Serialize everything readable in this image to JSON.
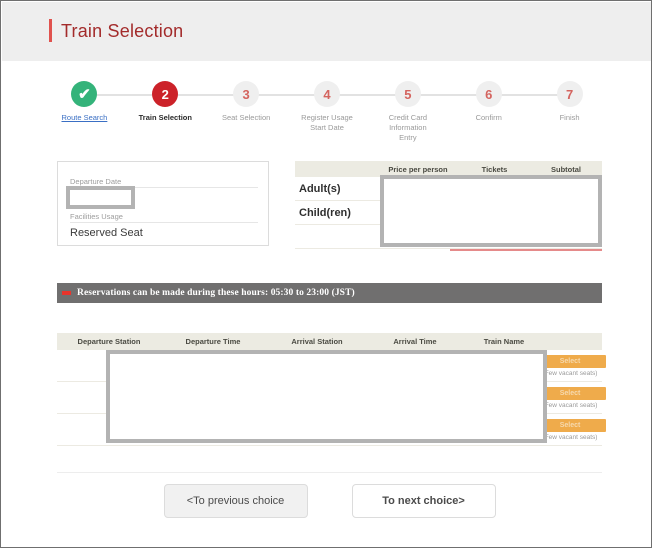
{
  "header": {
    "title": "Train Selection",
    "accent_color": "#e0524e",
    "title_color": "#a32b2b"
  },
  "stepper": {
    "steps": [
      {
        "number": "✔",
        "label": "Route Search",
        "state": "done"
      },
      {
        "number": "2",
        "label": "Train Selection",
        "state": "active"
      },
      {
        "number": "3",
        "label": "Seat Selection",
        "state": "todo"
      },
      {
        "number": "4",
        "label": "Register Usage\nStart Date",
        "state": "todo"
      },
      {
        "number": "5",
        "label": "Credit Card\nInformation\nEntry",
        "state": "todo"
      },
      {
        "number": "6",
        "label": "Confirm",
        "state": "todo"
      },
      {
        "number": "7",
        "label": "Finish",
        "state": "todo"
      }
    ],
    "done_color": "#34b37a",
    "active_color": "#cc2229",
    "todo_color": "#efefef"
  },
  "summary": {
    "departure_date_label": "Departure Date",
    "departure_date_value": "",
    "facilities_usage_label": "Facilities Usage",
    "facilities_usage_value": "Reserved Seat"
  },
  "fare_table": {
    "columns": [
      "",
      "Price per person",
      "Tickets",
      "Subtotal"
    ],
    "rows": [
      {
        "label": "Adult(s)",
        "price": "",
        "tickets": "",
        "subtotal": ""
      },
      {
        "label": "Child(ren)",
        "price": "",
        "tickets": "",
        "subtotal": ""
      },
      {
        "label": "",
        "price": "",
        "tickets": "",
        "subtotal": ""
      }
    ],
    "header_bg": "#ecebe2",
    "underline_color": "#e58a8a"
  },
  "notice": {
    "text": "Reservations can be made during these hours: 05:30 to 23:00 (JST)",
    "bg": "#706f6f",
    "mark_color": "#e8342c"
  },
  "train_table": {
    "columns": [
      "Departure Station",
      "Departure Time",
      "Arrival Station",
      "Arrival Time",
      "Train Name"
    ],
    "rows": [
      {
        "departure_station": "",
        "departure_time": "",
        "arrival_station": "",
        "arrival_time": "",
        "train_name": "",
        "select_label": "Select",
        "availability": "(Few vacant seats)"
      },
      {
        "departure_station": "",
        "departure_time": "",
        "arrival_station": "",
        "arrival_time": "",
        "train_name": "",
        "select_label": "Select",
        "availability": "(Few vacant seats)"
      },
      {
        "departure_station": "",
        "departure_time": "",
        "arrival_station": "",
        "arrival_time": "",
        "train_name": "",
        "select_label": "Select",
        "availability": "(Few vacant seats)"
      }
    ],
    "select_color": "#efab4b"
  },
  "footer": {
    "previous_label": "<To previous choice",
    "next_label": "To next choice>"
  }
}
